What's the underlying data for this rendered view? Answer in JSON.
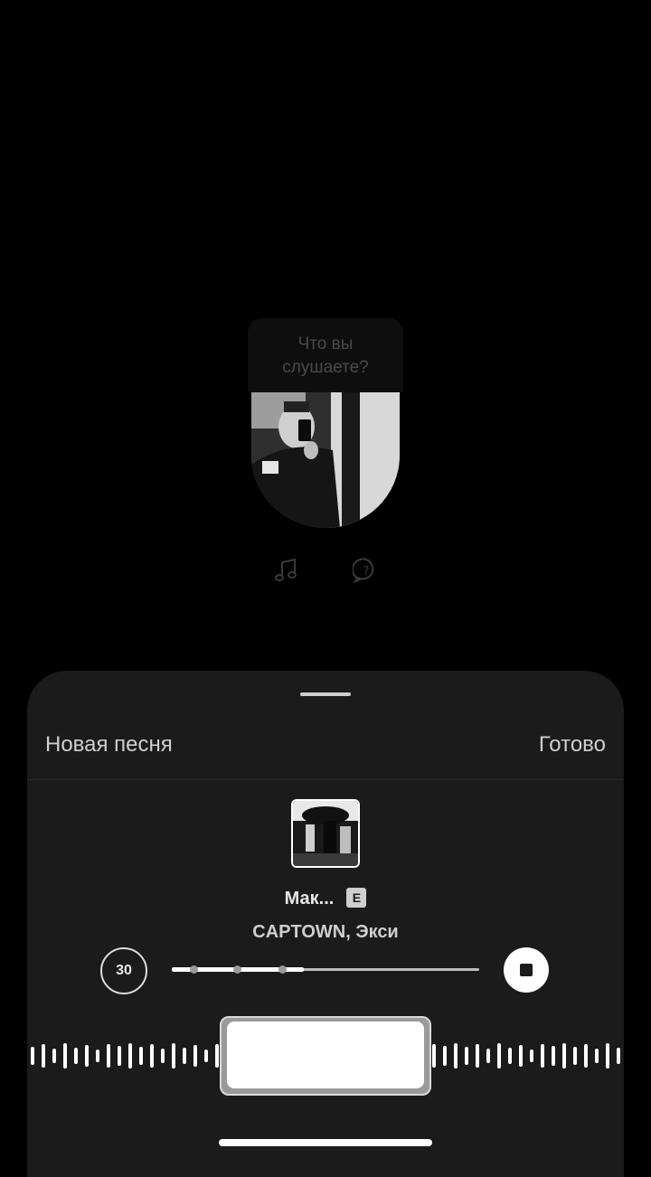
{
  "story": {
    "question": "Что вы слушаете?",
    "icons": [
      "music-note-icon",
      "question-bubble-icon"
    ]
  },
  "sheet": {
    "title": "Новая песня",
    "done_label": "Готово",
    "track": {
      "title": "Мак...",
      "explicit_badge": "E",
      "artist": "CAPTOWN, Экси"
    },
    "duration_label": "30",
    "progress_fraction": 0.43,
    "selection": {
      "start_fraction": 0.32,
      "end_fraction": 0.68
    }
  },
  "colors": {
    "sheet_bg": "#1b1b1b",
    "accent": "#ffffff",
    "muted_text": "#cfcfcf"
  }
}
